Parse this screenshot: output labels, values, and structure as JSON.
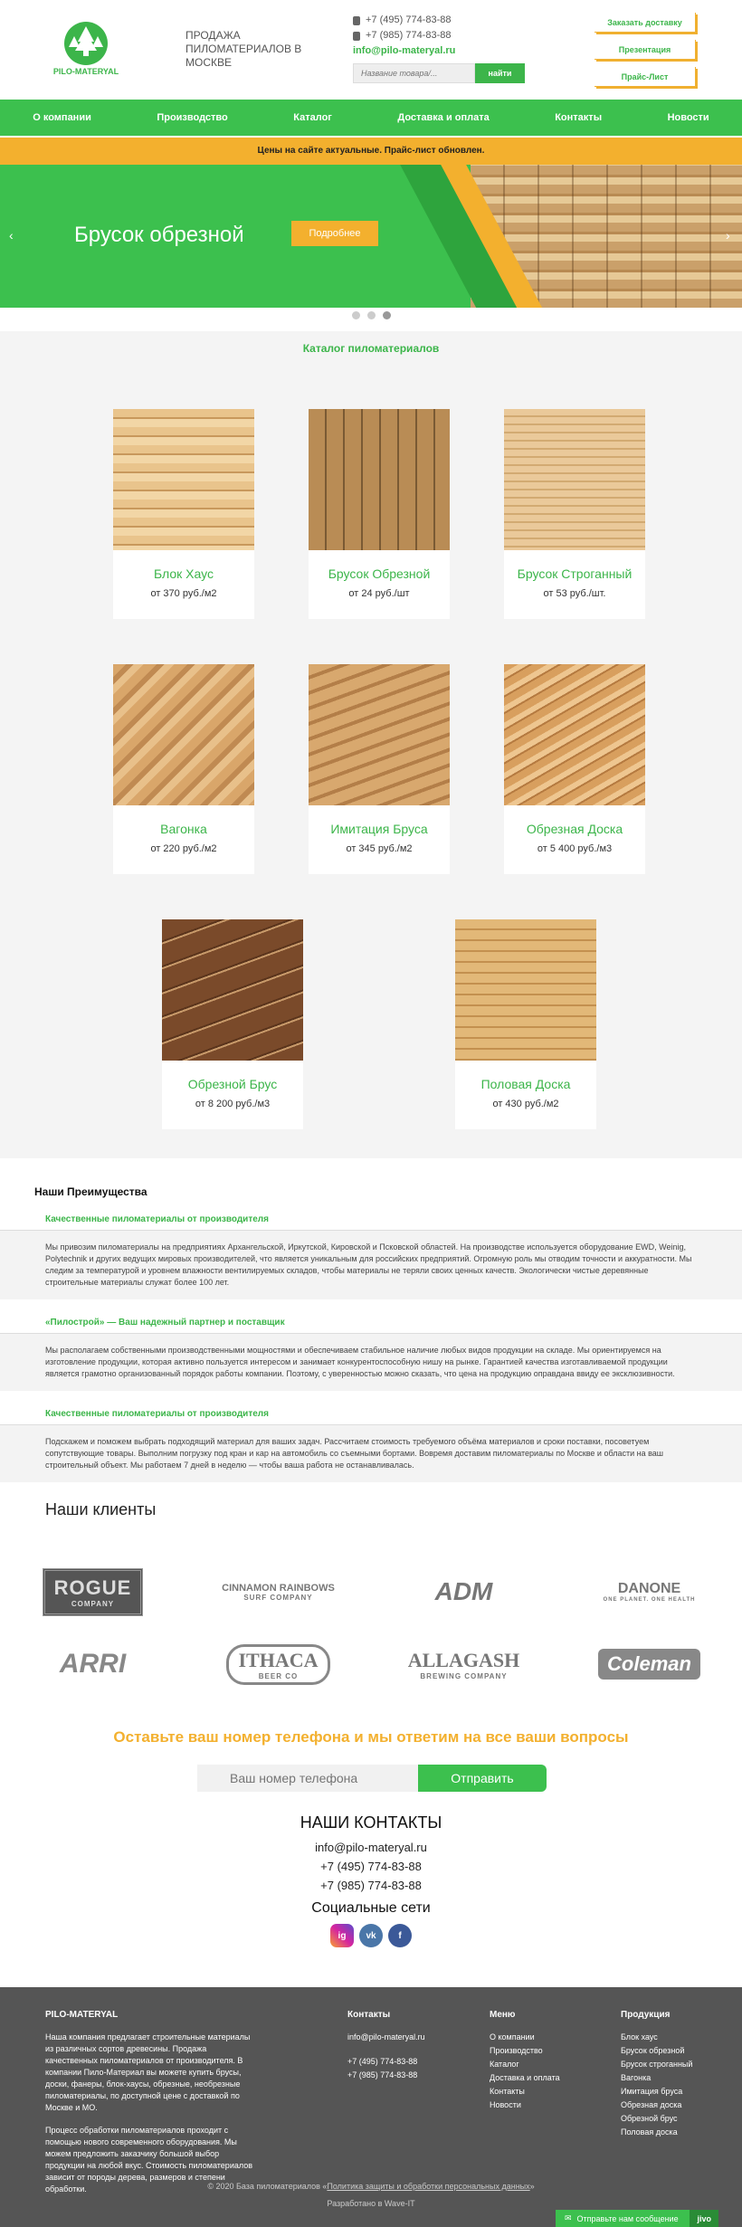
{
  "header": {
    "logo_text": "PILO-MATERYAL",
    "tagline": "ПРОДАЖА ПИЛОМАТЕРИАЛОВ В МОСКВЕ",
    "phone1": "+7 (495) 774-83-88",
    "phone2": "+7 (985) 774-83-88",
    "email": "info@pilo-materyal.ru",
    "search_placeholder": "Название товара/...",
    "search_button": "найти",
    "btn_delivery": "Заказать доставку",
    "btn_presentation": "Презентация",
    "btn_pricelist": "Прайс-Лист"
  },
  "nav": [
    "О компании",
    "Производство",
    "Каталог",
    "Доставка и оплата",
    "Контакты",
    "Новости"
  ],
  "notice": "Цены на сайте актуальные. Прайс-лист обновлен.",
  "slider": {
    "title": "Брусок обрезной",
    "button": "Подробнее",
    "prev": "‹",
    "next": "›"
  },
  "catalog": {
    "title": "Каталог пиломатериалов",
    "items": [
      {
        "name": "Блок Хаус",
        "price": "от 370 руб./м2"
      },
      {
        "name": "Брусок Обрезной",
        "price": "от 24 руб./шт"
      },
      {
        "name": "Брусок Строганный",
        "price": "от 53 руб./шт."
      },
      {
        "name": "Вагонка",
        "price": "от 220 руб./м2"
      },
      {
        "name": "Имитация Бруса",
        "price": "от 345 руб./м2"
      },
      {
        "name": "Обрезная Доска",
        "price": "от 5 400 руб./м3"
      },
      {
        "name": "Обрезной Брус",
        "price": "от 8 200 руб./м3"
      },
      {
        "name": "Половая Доска",
        "price": "от 430 руб./м2"
      }
    ]
  },
  "advantages": {
    "title": "Наши Преимущества",
    "blocks": [
      {
        "head": "Качественные пиломатериалы от производителя",
        "text": "Мы привозим пиломатериалы на предприятиях Архангельской, Иркутской, Кировской и Псковской областей. На производстве используется оборудование EWD, Weinig, Polytechnik и других ведущих мировых производителей, что является уникальным для российских предприятий. Огромную роль мы отводим точности и аккуратности. Мы следим за температурой и уровнем влажности вентилируемых складов, чтобы материалы не теряли своих ценных качеств. Экологически чистые деревянные строительные материалы служат более 100 лет."
      },
      {
        "head": "«Пилострой» — Ваш надежный партнер и поставщик",
        "text": "Мы располагаем собственными производственными мощностями и обеспечиваем стабильное наличие любых видов продукции на складе. Мы ориентируемся на изготовление продукции, которая активно пользуется интересом и занимает конкурентоспособную нишу на рынке. Гарантией качества изготавливаемой продукции является грамотно организованный порядок работы компании. Поэтому, с уверенностью можно сказать, что цена на продукцию оправдана ввиду ее эксклюзивности."
      },
      {
        "head": "Качественные пиломатериалы от производителя",
        "text": "Подскажем и поможем выбрать подходящий материал для ваших задач. Рассчитаем стоимость требуемого объёма материалов и сроки поставки, посоветуем сопутствующие товары. Выполним погрузку под кран и кар на автомобиль со съемными бортами. Вовремя доставим пиломатериалы по Москве и области на ваш строительный объект. Мы работаем 7 дней в неделю — чтобы ваша работа не останавливалась."
      }
    ]
  },
  "clients": {
    "title": "Наши клиенты",
    "logos": [
      {
        "big": "ROGUE",
        "small": "COMPANY"
      },
      {
        "big": "CINNAMON RAINBOWS",
        "small": "SURF COMPANY"
      },
      {
        "big": "ADM",
        "small": ""
      },
      {
        "big": "DANONE",
        "small": "ONE PLANET. ONE HEALTH"
      },
      {
        "big": "ARRI",
        "small": ""
      },
      {
        "big": "ITHACA",
        "small": "BEER CO"
      },
      {
        "big": "ALLAGASH",
        "small": "BREWING COMPANY"
      },
      {
        "big": "Coleman",
        "small": ""
      }
    ]
  },
  "cta": {
    "title": "Оставьте ваш номер телефона и мы ответим на все ваши вопросы",
    "placeholder": "Ваш номер телефона",
    "button": "Отправить"
  },
  "contacts": {
    "title": "НАШИ КОНТАКТЫ",
    "email": "info@pilo-materyal.ru",
    "phone1": "+7 (495) 774-83-88",
    "phone2": "+7 (985) 774-83-88",
    "social_title": "Социальные сети",
    "social": [
      "ig",
      "vk",
      "f"
    ]
  },
  "footer": {
    "about_title": "PILO-MATERYAL",
    "about_text1": "Наша компания предлагает строительные материалы из различных сортов древесины. Продажа качественных пиломатериалов от производителя. В компании Пило-Материал вы можете купить брусы, доски, фанеры, блок-хаусы, обрезные, необрезные пиломатериалы, по доступной цене с доставкой по Москве и МО.",
    "about_text2": "Процесс обработки пиломатериалов проходит с помощью нового современного оборудования. Мы можем предложить заказчику большой выбор продукции на любой вкус. Стоимость пиломатериалов зависит от породы дерева, размеров и степени обработки.",
    "contacts_title": "Контакты",
    "contacts": [
      "info@pilo-materyal.ru",
      "+7 (495) 774-83-88",
      "+7 (985) 774-83-88"
    ],
    "menu_title": "Меню",
    "menu": [
      "О компании",
      "Производство",
      "Каталог",
      "Доставка и оплата",
      "Контакты",
      "Новости"
    ],
    "products_title": "Продукция",
    "products": [
      "Блок хаус",
      "Брусок обрезной",
      "Брусок строганный",
      "Вагонка",
      "Имитация бруса",
      "Обрезная доска",
      "Обрезной брус",
      "Половая доска"
    ],
    "copyright": "© 2020 База пиломатериалов «",
    "policy": "Политика защиты и обработки персональных данных",
    "copyright_end": "»",
    "developer": "Разработано в Wave-IT",
    "chat": "Отправьте нам сообщение",
    "chat_brand": "jivo"
  }
}
